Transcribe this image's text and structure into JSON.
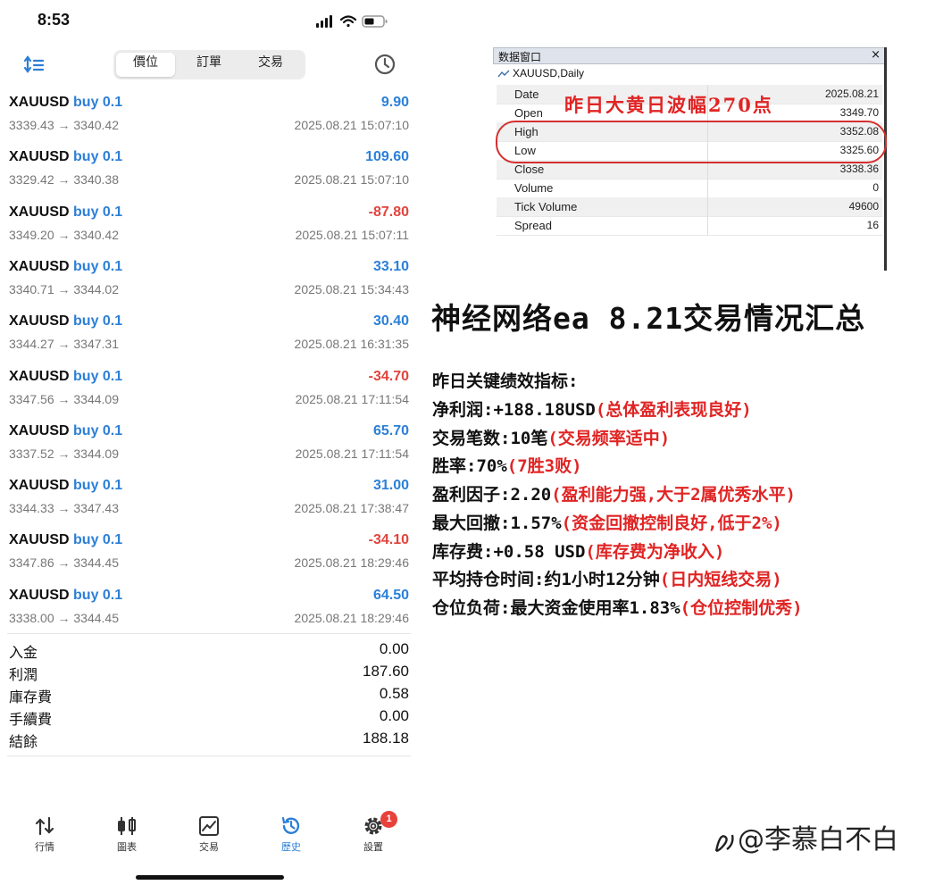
{
  "status_bar": {
    "time": "8:53"
  },
  "header": {
    "tabs": [
      {
        "label": "價位",
        "active": true
      },
      {
        "label": "訂單",
        "active": false
      },
      {
        "label": "交易",
        "active": false
      }
    ]
  },
  "trades": [
    {
      "symbol": "XAUUSD",
      "side": "buy 0.1",
      "profit": "9.90",
      "prices": "3339.43 → 3340.42",
      "time": "2025.08.21 15:07:10"
    },
    {
      "symbol": "XAUUSD",
      "side": "buy 0.1",
      "profit": "109.60",
      "prices": "3329.42 → 3340.38",
      "time": "2025.08.21 15:07:10"
    },
    {
      "symbol": "XAUUSD",
      "side": "buy 0.1",
      "profit": "-87.80",
      "prices": "3349.20 → 3340.42",
      "time": "2025.08.21 15:07:11"
    },
    {
      "symbol": "XAUUSD",
      "side": "buy 0.1",
      "profit": "33.10",
      "prices": "3340.71 → 3344.02",
      "time": "2025.08.21 15:34:43"
    },
    {
      "symbol": "XAUUSD",
      "side": "buy 0.1",
      "profit": "30.40",
      "prices": "3344.27 → 3347.31",
      "time": "2025.08.21 16:31:35"
    },
    {
      "symbol": "XAUUSD",
      "side": "buy 0.1",
      "profit": "-34.70",
      "prices": "3347.56 → 3344.09",
      "time": "2025.08.21 17:11:54"
    },
    {
      "symbol": "XAUUSD",
      "side": "buy 0.1",
      "profit": "65.70",
      "prices": "3337.52 → 3344.09",
      "time": "2025.08.21 17:11:54"
    },
    {
      "symbol": "XAUUSD",
      "side": "buy 0.1",
      "profit": "31.00",
      "prices": "3344.33 → 3347.43",
      "time": "2025.08.21 17:38:47"
    },
    {
      "symbol": "XAUUSD",
      "side": "buy 0.1",
      "profit": "-34.10",
      "prices": "3347.86 → 3344.45",
      "time": "2025.08.21 18:29:46"
    },
    {
      "symbol": "XAUUSD",
      "side": "buy 0.1",
      "profit": "64.50",
      "prices": "3338.00 → 3344.45",
      "time": "2025.08.21 18:29:46"
    }
  ],
  "summary": [
    {
      "label": "入金",
      "value": "0.00"
    },
    {
      "label": "利潤",
      "value": "187.60"
    },
    {
      "label": "庫存費",
      "value": "0.58"
    },
    {
      "label": "手續費",
      "value": "0.00"
    },
    {
      "label": "結餘",
      "value": "188.18"
    }
  ],
  "navbar": {
    "items": [
      {
        "label": "行情",
        "icon": "quotes-icon"
      },
      {
        "label": "圖表",
        "icon": "chart-icon"
      },
      {
        "label": "交易",
        "icon": "trade-icon"
      },
      {
        "label": "歷史",
        "icon": "history-icon",
        "active": true
      },
      {
        "label": "設置",
        "icon": "settings-icon",
        "badge": "1"
      }
    ]
  },
  "data_window": {
    "title": "数据窗口",
    "close": "×",
    "symbol": "XAUUSD,Daily",
    "rows": [
      {
        "key": "Date",
        "value": "2025.08.21"
      },
      {
        "key": "Open",
        "value": "3349.70"
      },
      {
        "key": "High",
        "value": "3352.08"
      },
      {
        "key": "Low",
        "value": "3325.60"
      },
      {
        "key": "Close",
        "value": "3338.36"
      },
      {
        "key": "Volume",
        "value": "0"
      },
      {
        "key": "Tick Volume",
        "value": "49600"
      },
      {
        "key": "Spread",
        "value": "16"
      }
    ],
    "annotation": "昨日大黄日波幅270点"
  },
  "report": {
    "title": "神经网络ea 8.21交易情况汇总",
    "heading": "昨日关键绩效指标:",
    "lines": [
      {
        "label": "净利润:",
        "value": "+188.18USD",
        "note": "(总体盈利表现良好)"
      },
      {
        "label": "交易笔数:",
        "value": "10笔",
        "note": "(交易频率适中)"
      },
      {
        "label": "胜率:",
        "value": "70%",
        "note": "(7胜3败)"
      },
      {
        "label": "盈利因子:",
        "value": "2.20",
        "note": "(盈利能力强,大于2属优秀水平)"
      },
      {
        "label": "最大回撤:",
        "value": "1.57%",
        "note": "(资金回撤控制良好,低于2%)"
      },
      {
        "label": "库存费:",
        "value": "+0.58 USD",
        "note": "(库存费为净收入)"
      },
      {
        "label": "平均持仓时间:",
        "value": "约1小时12分钟",
        "note": "(日内短线交易)"
      },
      {
        "label": "仓位负荷:",
        "value": "最大资金使用率1.83%",
        "note": "(仓位控制优秀)"
      }
    ]
  },
  "watermark": "@李慕白不白",
  "colors": {
    "accent": "#2d7fd6",
    "profit_positive": "#2b80d8",
    "profit_negative": "#e0443c",
    "annotation_red": "#e02424"
  }
}
